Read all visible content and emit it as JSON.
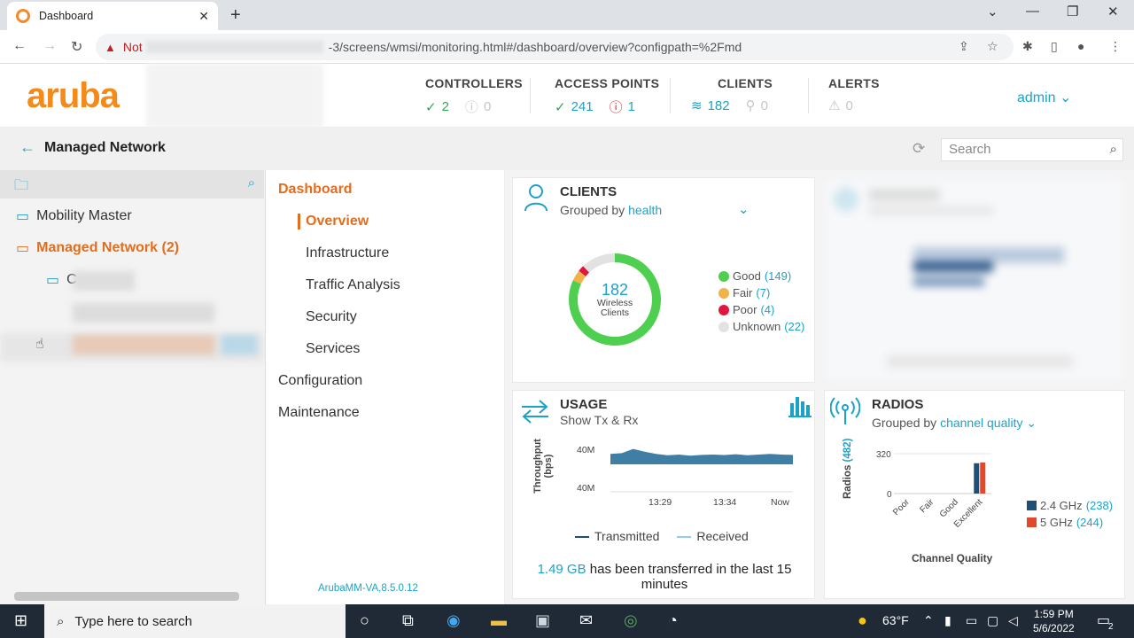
{
  "browser": {
    "tab_title": "Dashboard",
    "close_glyph": "✕",
    "new_tab_glyph": "+",
    "url_security": "Not",
    "url_path": "-3/screens/wmsi/monitoring.html#/dashboard/overview?configpath=%2Fmd"
  },
  "app": {
    "logo": "aruba",
    "user": "admin",
    "stats": [
      {
        "label": "CONTROLLERS",
        "ok": "2",
        "second": "0"
      },
      {
        "label": "ACCESS POINTS",
        "ok": "241",
        "second": "1"
      },
      {
        "label": "CLIENTS",
        "ok": "182",
        "second": "0"
      },
      {
        "label": "ALERTS",
        "ok": "0"
      }
    ]
  },
  "breadcrumb": {
    "title": "Managed Network",
    "search_placeholder": "Search"
  },
  "tree": {
    "items": [
      {
        "label": "Mobility Master"
      },
      {
        "label": "Managed Network (2)"
      },
      {
        "label": "C"
      }
    ]
  },
  "menu": {
    "dashboard": "Dashboard",
    "overview": "Overview",
    "infrastructure": "Infrastructure",
    "traffic": "Traffic Analysis",
    "security": "Security",
    "services": "Services",
    "configuration": "Configuration",
    "maintenance": "Maintenance",
    "version": "ArubaMM-VA,8.5.0.12"
  },
  "clients_card": {
    "title": "CLIENTS",
    "grouped_by": "Grouped by",
    "group_value": "health",
    "center_value": "182",
    "center_label_1": "Wireless",
    "center_label_2": "Clients",
    "legend": [
      {
        "label": "Good",
        "count": "(149)",
        "value": 149,
        "color": "#4fcf4f"
      },
      {
        "label": "Fair",
        "count": "(7)",
        "value": 7,
        "color": "#f0b24a"
      },
      {
        "label": "Poor",
        "count": "(4)",
        "value": 4,
        "color": "#e0163f"
      },
      {
        "label": "Unknown",
        "count": "(22)",
        "value": 22,
        "color": "#e2e2e2"
      }
    ]
  },
  "usage_card": {
    "title": "USAGE",
    "subtitle": "Show Tx & Rx",
    "ylabel_1": "Throughput",
    "ylabel_2": "(bps)",
    "ytick_top": "40M",
    "ytick_bottom": "40M",
    "xticks": [
      "13:29",
      "13:34",
      "Now"
    ],
    "legend_tx": "Transmitted",
    "legend_rx": "Received",
    "summary_value": "1.49 GB",
    "summary_text": "has been transferred in the last 15 minutes"
  },
  "radios_card": {
    "title": "RADIOS",
    "grouped_by": "Grouped by",
    "group_value": "channel quality",
    "ylabel": "Radios",
    "ycount": "(482)",
    "xlabel": "Channel Quality"
  },
  "taskbar": {
    "search_placeholder": "Type here to search",
    "weather": "63°F",
    "time": "1:59 PM",
    "date": "5/6/2022",
    "notifications": "2"
  },
  "chart_data": [
    {
      "type": "pie",
      "title": "CLIENTS",
      "categories": [
        "Good",
        "Fair",
        "Poor",
        "Unknown"
      ],
      "values": [
        149,
        7,
        4,
        22
      ]
    },
    {
      "type": "area",
      "title": "USAGE",
      "ylabel": "Throughput (bps)",
      "x_ticks": [
        "13:29",
        "13:34",
        "Now"
      ],
      "series": [
        {
          "name": "Transmitted",
          "values": [
            0.55,
            0.6,
            0.9,
            0.7,
            0.55,
            0.45,
            0.5,
            0.42,
            0.48,
            0.5,
            0.47,
            0.52,
            0.45,
            0.5,
            0.55,
            0.5,
            0.48
          ]
        }
      ]
    },
    {
      "type": "bar",
      "title": "RADIOS",
      "xlabel": "Channel Quality",
      "ylabel": "Radios",
      "ylim": [
        0,
        320
      ],
      "yticks": [
        "320",
        "0"
      ],
      "categories": [
        "Poor",
        "Fair",
        "Good",
        "Excellent"
      ],
      "series": [
        {
          "name": "2.4 GHz",
          "count": "(238)",
          "color": "#1f4e79",
          "values": [
            0,
            0,
            0,
            238
          ]
        },
        {
          "name": "5 GHz",
          "count": "(244)",
          "color": "#e04a2a",
          "values": [
            0,
            0,
            0,
            244
          ]
        }
      ]
    }
  ]
}
